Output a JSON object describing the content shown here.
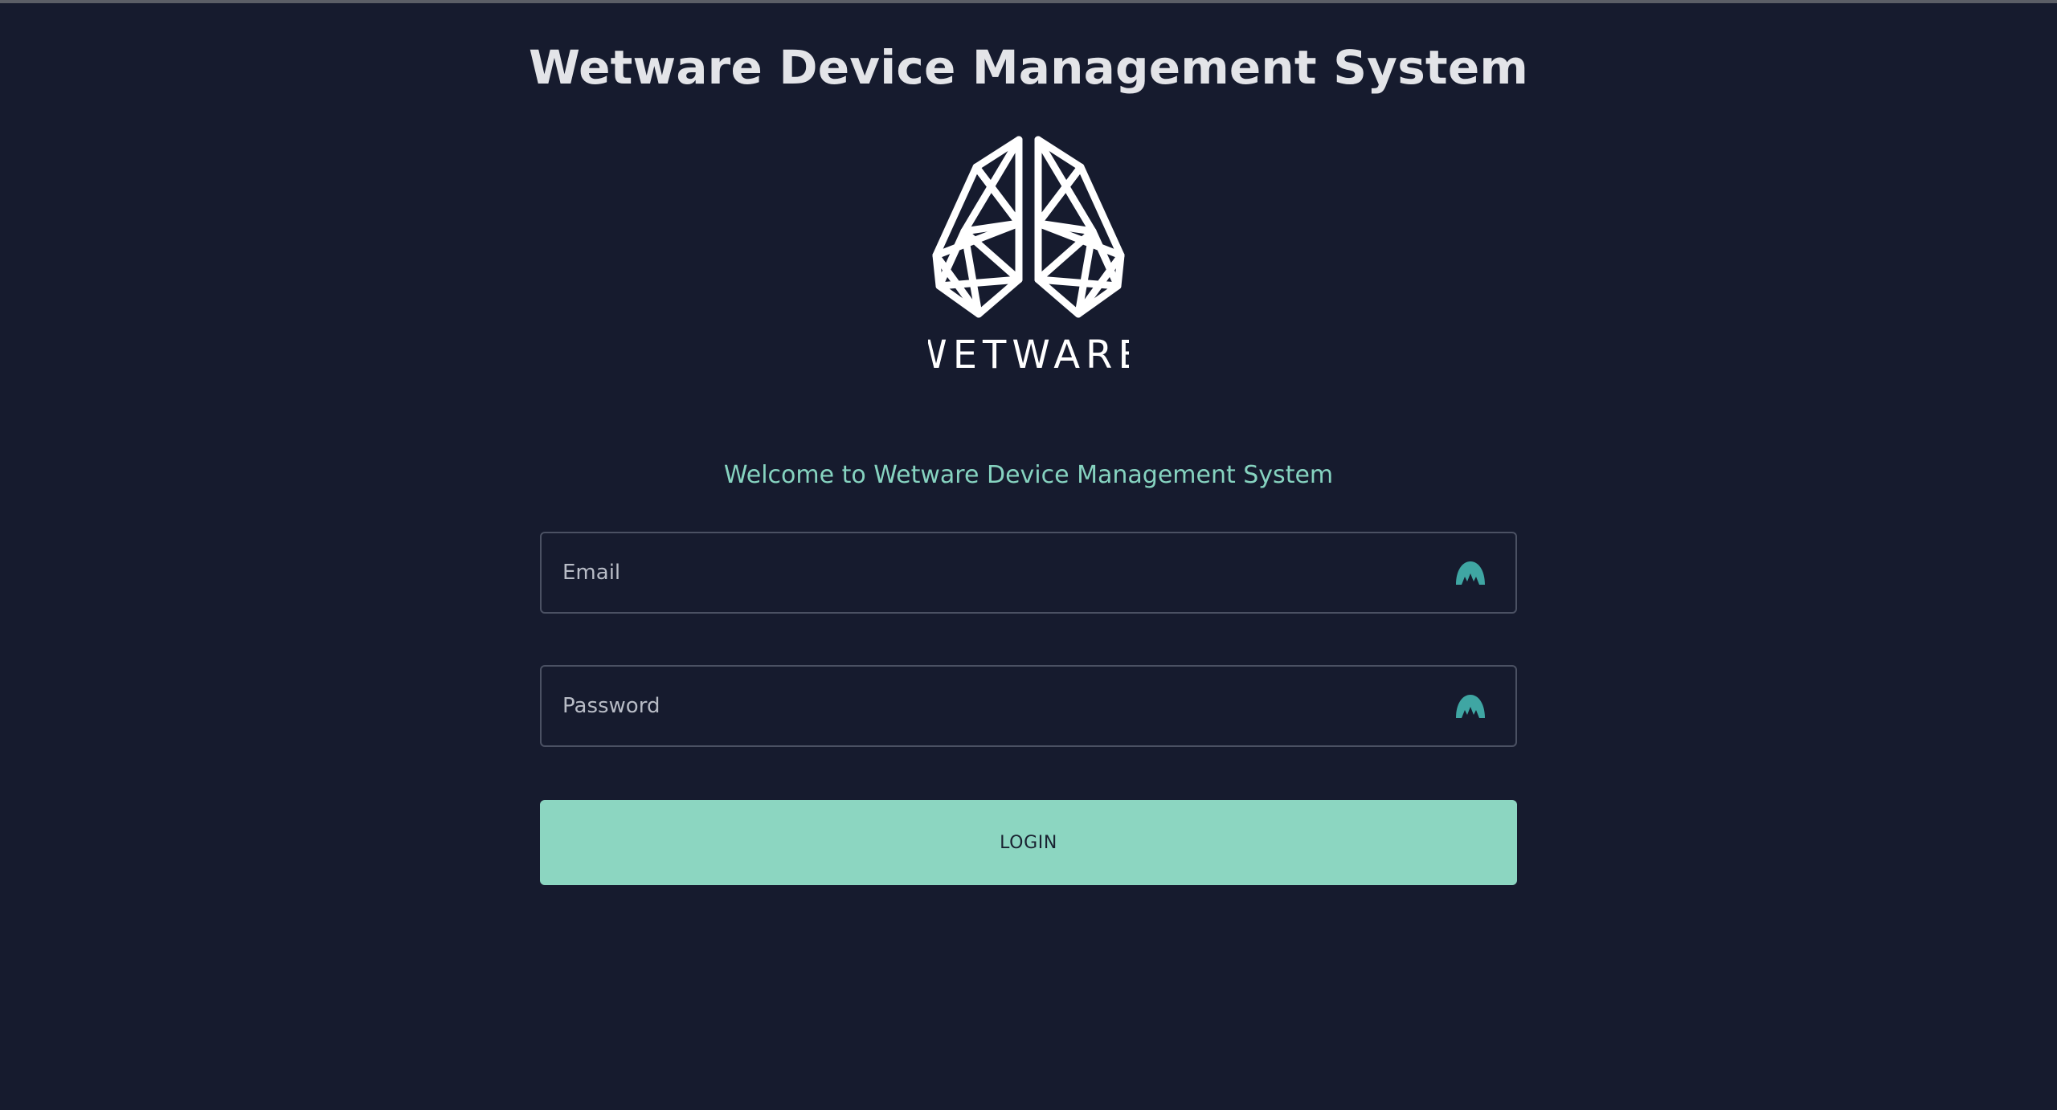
{
  "header": {
    "title": "Wetware Device Management System"
  },
  "logo": {
    "name": "brain-logo-icon",
    "wordmark": "WETWARE"
  },
  "welcome_text": "Welcome to Wetware Device Management System",
  "form": {
    "email": {
      "placeholder": "Email",
      "value": "",
      "icon": "password-manager-icon"
    },
    "password": {
      "placeholder": "Password",
      "value": "",
      "icon": "password-manager-icon"
    },
    "login_label": "LOGIN"
  },
  "colors": {
    "background": "#161b2e",
    "accent": "#8cd6c1",
    "welcome_text": "#86d3c0",
    "field_icon": "#3fa6a3"
  }
}
